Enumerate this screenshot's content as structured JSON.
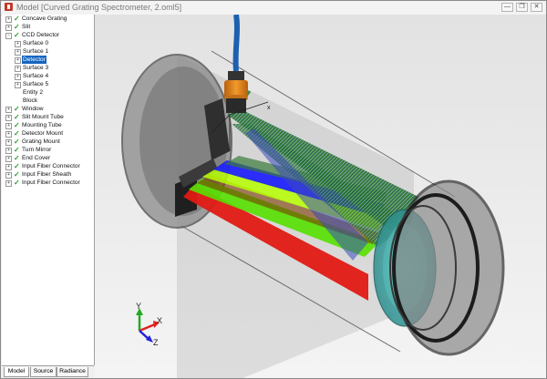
{
  "window": {
    "title": "Model [Curved Grating Spectrometer, 2.oml5]",
    "minimize_glyph": "—",
    "maximize_glyph": "❐",
    "close_glyph": "✕"
  },
  "tree": {
    "items": [
      {
        "label": "Concave Grating"
      },
      {
        "label": "Slit"
      },
      {
        "label": "CCD Detector"
      },
      {
        "label": "Surface 0"
      },
      {
        "label": "Surface 1"
      },
      {
        "label": "Detector"
      },
      {
        "label": "Surface 3"
      },
      {
        "label": "Surface 4"
      },
      {
        "label": "Surface 5"
      },
      {
        "label": "Entity 2"
      },
      {
        "label": "Block"
      },
      {
        "label": "Window"
      },
      {
        "label": "Slit Mount Tube"
      },
      {
        "label": "Mounting Tube"
      },
      {
        "label": "Detector Mount"
      },
      {
        "label": "Grating Mount"
      },
      {
        "label": "Turn Mirror"
      },
      {
        "label": "End Cover"
      },
      {
        "label": "Input Fiber Connector"
      },
      {
        "label": "Input Fiber Sheath"
      },
      {
        "label": "Input Fiber Connector"
      }
    ]
  },
  "tabs": [
    {
      "label": "Model"
    },
    {
      "label": "Source"
    },
    {
      "label": "Radiance"
    }
  ],
  "viewport": {
    "axis_y": "Y",
    "axis_x": "X",
    "axis_z": "Z",
    "coord_label": "x"
  },
  "colors": {
    "ray_red": "#e11a14",
    "ray_green": "#55e000",
    "ray_blue": "#1a1aff",
    "fiber_blue": "#1e5fb0",
    "connector_orange": "#e08a1c",
    "glass_teal": "#3aa5a5"
  }
}
